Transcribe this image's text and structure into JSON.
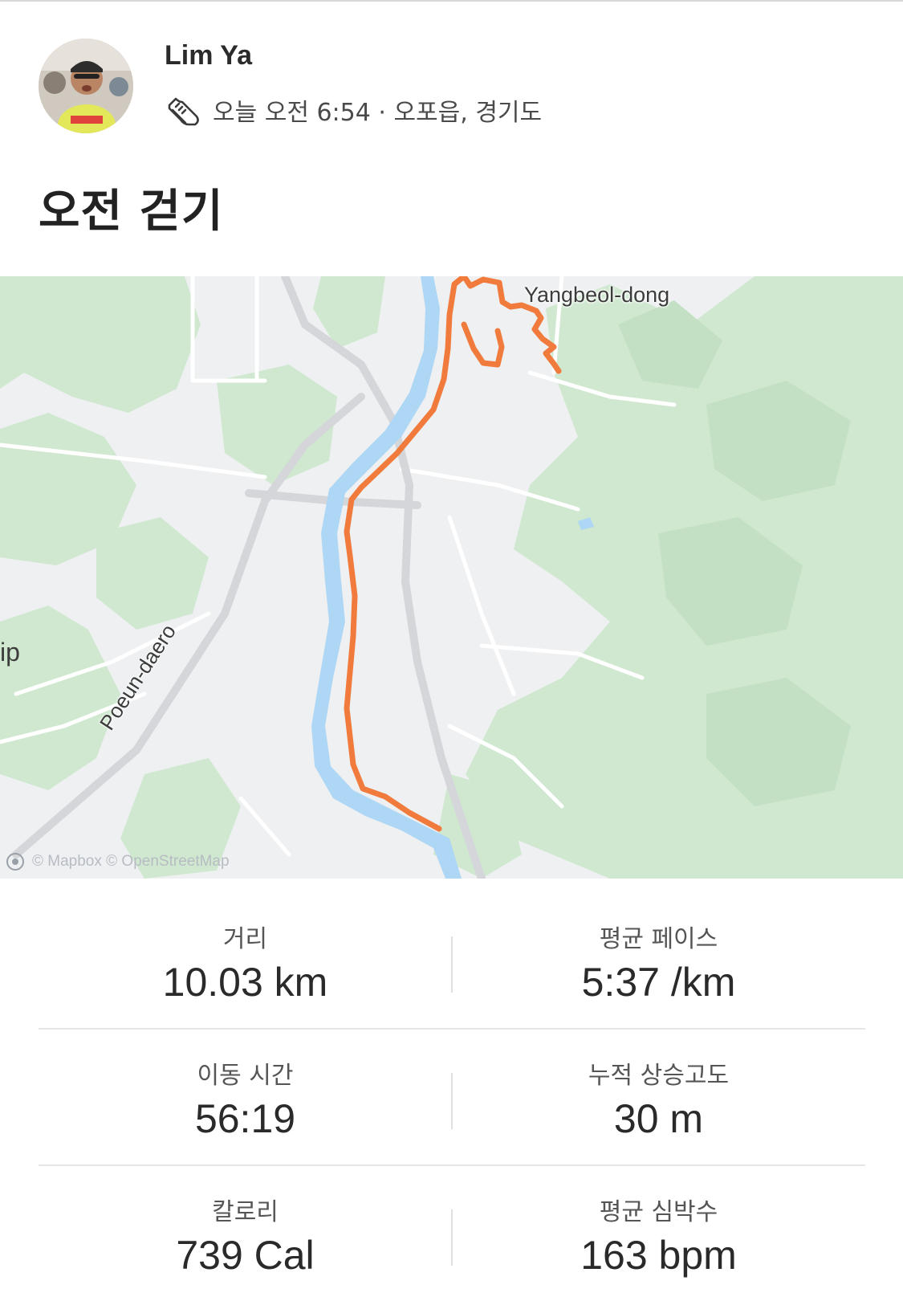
{
  "athlete": {
    "name": "Lim Ya",
    "meta": "오늘 오전 6:54 · 오포읍, 경기도",
    "activity_icon": "walking-shoe-icon"
  },
  "activity": {
    "title": "오전 걷기"
  },
  "map": {
    "place_label": "Yangbeol-dong",
    "road_label": "Poeun-daero",
    "edge_label": "ip",
    "attribution": "© Mapbox © OpenStreetMap",
    "route_color": "#f07b3c",
    "water_color": "#aed6f5",
    "park_color": "#cfe8cf"
  },
  "stats": [
    [
      {
        "label": "거리",
        "value": "10.03 km"
      },
      {
        "label": "평균 페이스",
        "value": "5:37 /km"
      }
    ],
    [
      {
        "label": "이동 시간",
        "value": "56:19"
      },
      {
        "label": "누적 상승고도",
        "value": "30 m"
      }
    ],
    [
      {
        "label": "칼로리",
        "value": "739 Cal"
      },
      {
        "label": "평균 심박수",
        "value": "163 bpm"
      }
    ]
  ]
}
